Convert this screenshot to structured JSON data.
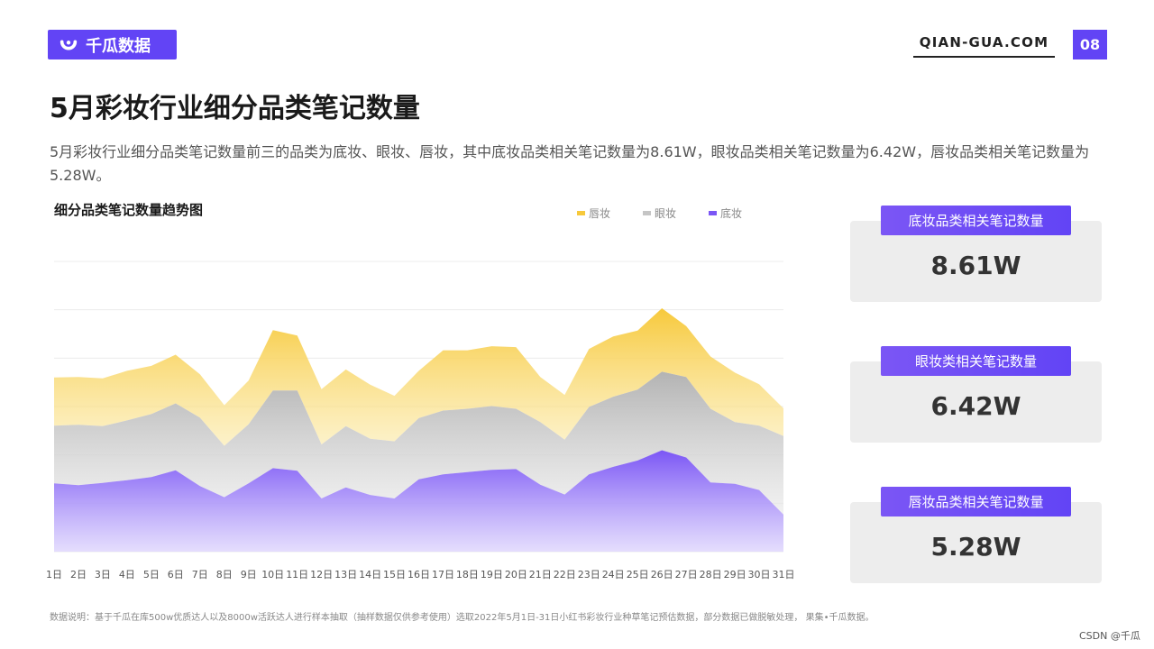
{
  "header": {
    "logo_text": "千瓜数据",
    "site": "QIAN-GUA.COM",
    "page_number": "08"
  },
  "title": "5月彩妆行业细分品类笔记数量",
  "description": "5月彩妆行业细分品类笔记数量前三的品类为底妆、眼妆、唇妆，其中底妆品类相关笔记数量为8.61W，眼妆品类相关笔记数量为6.42W，唇妆品类相关笔记数量为5.28W。",
  "cards": [
    {
      "label": "底妆品类相关笔记数量",
      "value": "8.61W"
    },
    {
      "label": "眼妆类相关笔记数量",
      "value": "6.42W"
    },
    {
      "label": "唇妆品类相关笔记数量",
      "value": "5.28W"
    }
  ],
  "footer": "数据说明：基于千瓜在库500w优质达人以及8000w活跃达人进行样本抽取（抽样数据仅供参考使用）选取2022年5月1日-31日小红书彩妆行业种草笔记预估数据，部分数据已做脱敏处理， 果集•千瓜数据。",
  "credit": "CSDN @千瓜",
  "colors": {
    "brand": "#6244f5",
    "lip": "#f7c93b",
    "eye": "#b7b7b7",
    "base": "#7b56f5"
  },
  "chart_data": {
    "type": "area",
    "title": "细分品类笔记数量趋势图",
    "stacked": true,
    "y_axis_labels": false,
    "grid": true,
    "legend_position": "top-right",
    "categories": [
      "1日",
      "2日",
      "3日",
      "4日",
      "5日",
      "6日",
      "7日",
      "8日",
      "9日",
      "10日",
      "11日",
      "12日",
      "13日",
      "14日",
      "15日",
      "16日",
      "17日",
      "18日",
      "19日",
      "20日",
      "21日",
      "22日",
      "23日",
      "24日",
      "25日",
      "26日",
      "27日",
      "28日",
      "29日",
      "30日",
      "31日"
    ],
    "series": [
      {
        "name": "底妆",
        "color": "#7b56f5",
        "values": [
          1.53,
          1.49,
          1.54,
          1.6,
          1.67,
          1.82,
          1.47,
          1.22,
          1.53,
          1.87,
          1.81,
          1.19,
          1.44,
          1.27,
          1.19,
          1.62,
          1.73,
          1.78,
          1.83,
          1.85,
          1.5,
          1.28,
          1.73,
          1.9,
          2.04,
          2.27,
          2.11,
          1.55,
          1.52,
          1.38,
          0.83
        ]
      },
      {
        "name": "眼妆",
        "color": "#b7b7b7",
        "values": [
          1.29,
          1.35,
          1.27,
          1.34,
          1.41,
          1.5,
          1.53,
          1.15,
          1.32,
          1.74,
          1.8,
          1.21,
          1.37,
          1.26,
          1.28,
          1.37,
          1.43,
          1.42,
          1.43,
          1.35,
          1.4,
          1.23,
          1.51,
          1.57,
          1.59,
          1.76,
          1.8,
          1.65,
          1.38,
          1.44,
          1.76
        ]
      },
      {
        "name": "唇妆",
        "color": "#f7c93b",
        "values": [
          1.08,
          1.07,
          1.07,
          1.11,
          1.08,
          1.09,
          0.97,
          0.91,
          0.98,
          1.35,
          1.23,
          1.24,
          1.27,
          1.21,
          1.02,
          1.06,
          1.35,
          1.31,
          1.34,
          1.38,
          1.01,
          1.0,
          1.3,
          1.35,
          1.32,
          1.42,
          1.14,
          1.17,
          1.11,
          0.93,
          0.62
        ]
      }
    ],
    "ylim": [
      0,
      6.5
    ]
  }
}
